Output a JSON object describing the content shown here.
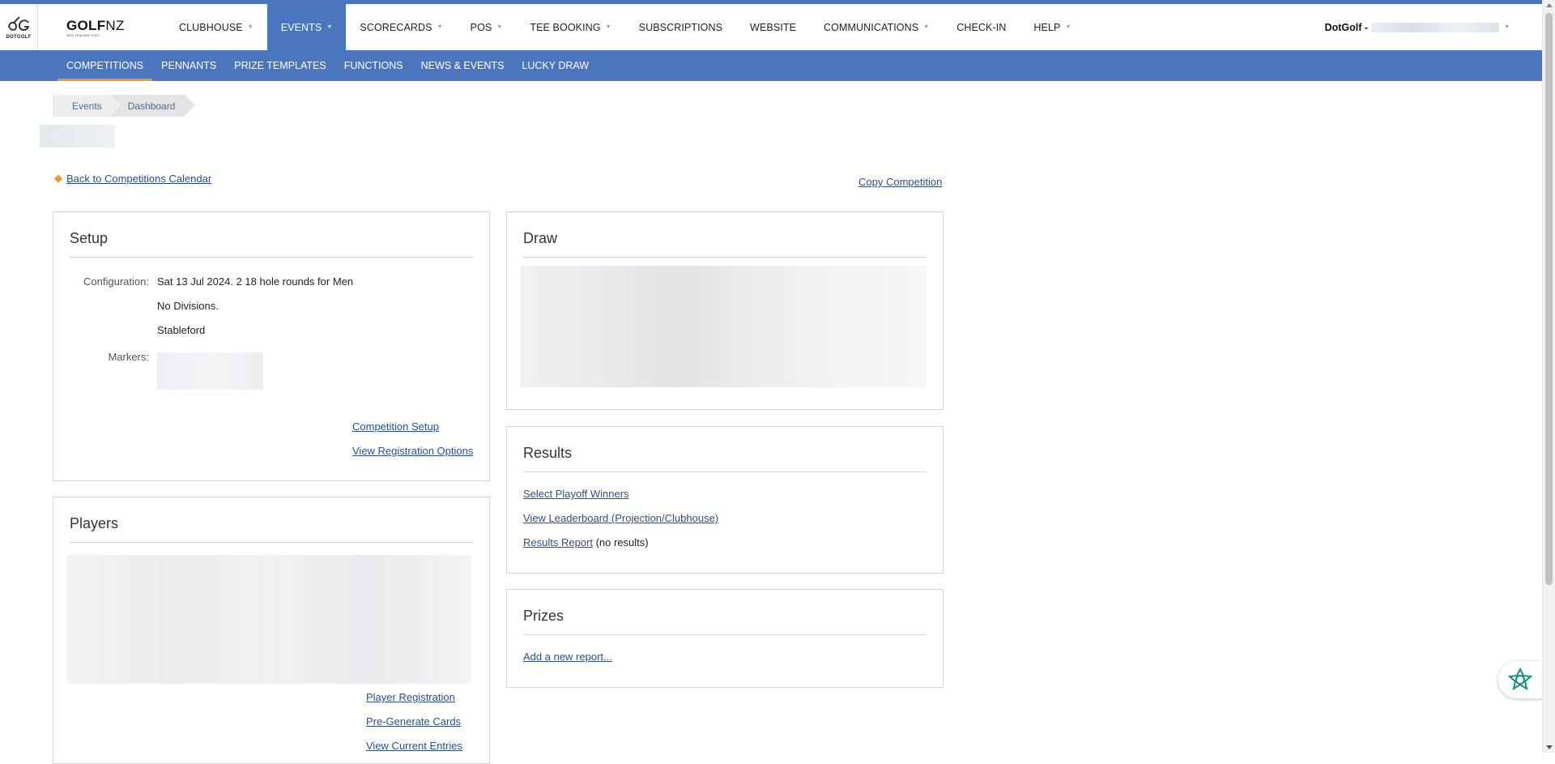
{
  "brand": {
    "dotgolf_label": "DOTGOLF",
    "golfnz_main": "GOLF",
    "golfnz_nz": "NZ",
    "golfnz_sub": "NEW ZEALAND GOLF"
  },
  "nav": {
    "items": [
      {
        "label": "CLUBHOUSE"
      },
      {
        "label": "EVENTS"
      },
      {
        "label": "SCORECARDS"
      },
      {
        "label": "POS"
      },
      {
        "label": "TEE BOOKING"
      },
      {
        "label": "SUBSCRIPTIONS"
      },
      {
        "label": "WEBSITE"
      },
      {
        "label": "COMMUNICATIONS"
      },
      {
        "label": "CHECK-IN"
      },
      {
        "label": "HELP"
      }
    ],
    "user": "DotGolf -"
  },
  "subnav": {
    "items": [
      {
        "label": "COMPETITIONS"
      },
      {
        "label": "PENNANTS"
      },
      {
        "label": "PRIZE TEMPLATES"
      },
      {
        "label": "FUNCTIONS"
      },
      {
        "label": "NEWS & EVENTS"
      },
      {
        "label": "LUCKY DRAW"
      }
    ]
  },
  "breadcrumb": [
    "Events",
    "Dashboard"
  ],
  "links": {
    "back": "Back to Competitions Calendar",
    "copy": "Copy Competition"
  },
  "setup": {
    "title": "Setup",
    "config_label": "Configuration:",
    "config_line1": "Sat 13 Jul 2024. 2 18 hole rounds for Men",
    "config_line2": "No Divisions.",
    "config_line3": "Stableford",
    "markers_label": "Markers:",
    "link_setup": "Competition Setup",
    "link_registration": "View Registration Options"
  },
  "draw": {
    "title": "Draw"
  },
  "results": {
    "title": "Results",
    "link_playoff": "Select Playoff Winners",
    "link_leaderboard": "View Leaderboard (Projection/Clubhouse)",
    "link_report": "Results Report",
    "report_note": " (no results)"
  },
  "prizes": {
    "title": "Prizes",
    "link_add": "Add a new report..."
  },
  "players": {
    "title": "Players",
    "link_registration": "Player Registration",
    "link_pregenerate": "Pre-Generate Cards",
    "link_entries": "View Current Entries"
  },
  "colors": {
    "nav_blue": "#4a76be",
    "active_underline": "#e8972f",
    "link": "#2a4f8a"
  }
}
